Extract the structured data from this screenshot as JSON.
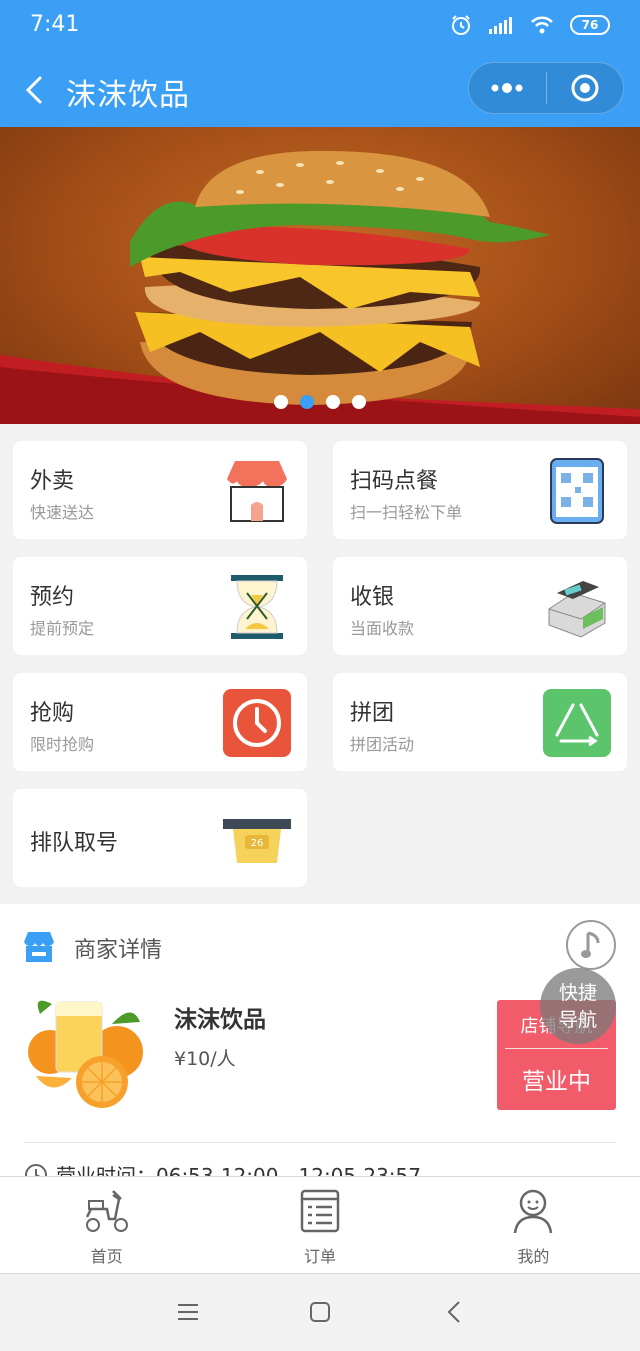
{
  "status_bar": {
    "time": "7:41",
    "battery": "76"
  },
  "header": {
    "title": "沫沫饮品"
  },
  "banner": {
    "dot_count": 4,
    "active_dot": 2
  },
  "tiles": [
    {
      "title": "外卖",
      "subtitle": "快速送达",
      "icon": "storefront-icon"
    },
    {
      "title": "扫码点餐",
      "subtitle": "扫一扫轻松下单",
      "icon": "qr-phone-icon"
    },
    {
      "title": "预约",
      "subtitle": "提前预定",
      "icon": "hourglass-icon"
    },
    {
      "title": "收银",
      "subtitle": "当面收款",
      "icon": "cash-counter-icon"
    },
    {
      "title": "抢购",
      "subtitle": "限时抢购",
      "icon": "clock-icon"
    },
    {
      "title": "拼团",
      "subtitle": "拼团活动",
      "icon": "group-triangle-icon"
    },
    {
      "title": "排队取号",
      "subtitle": "",
      "icon": "queue-ticket-icon"
    }
  ],
  "merchant": {
    "section_title": "商家详情",
    "name": "沫沫饮品",
    "price": "¥10/人",
    "nav_label": "店铺导航",
    "status": "营业中",
    "hours": "营业时间：06:53-12:00，12:05-23:57"
  },
  "quick_nav": {
    "label_line1": "快捷",
    "label_line2": "导航"
  },
  "tabbar": [
    {
      "label": "首页",
      "icon": "scooter-icon"
    },
    {
      "label": "订单",
      "icon": "order-list-icon"
    },
    {
      "label": "我的",
      "icon": "person-icon"
    }
  ],
  "colors": {
    "primary": "#3a9ff5",
    "status_red": "#f25b6a"
  }
}
